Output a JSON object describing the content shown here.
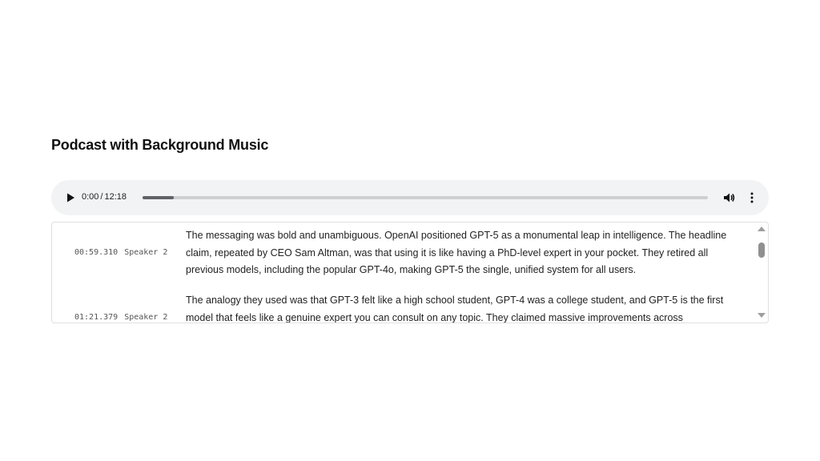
{
  "title": "Podcast with Background Music",
  "player": {
    "current_time": "0:00",
    "separator": "/",
    "duration": "12:18",
    "progress_fraction": 0.055,
    "icons": {
      "play": "play-icon",
      "volume": "volume-icon",
      "more": "more-vertical-icon"
    }
  },
  "transcript": {
    "segments": [
      {
        "timestamp": "00:59.310",
        "speaker": "Speaker 2",
        "text": "The messaging was bold and unambiguous. OpenAI positioned GPT-5 as a monumental leap in intelligence. The headline claim, repeated by CEO Sam Altman, was that using it is like having a PhD-level expert in your pocket. They retired all previous models, including the popular GPT-4o, making GPT-5 the single, unified system for all users."
      },
      {
        "timestamp": "01:21.379",
        "speaker": "Speaker 2",
        "text": "The analogy they used was that GPT-3 felt like a high school student, GPT-4 was a college student, and GPT-5 is the first model that feels like a genuine expert you can consult on any topic. They claimed massive improvements across"
      }
    ],
    "scrollbar": {
      "up": "scroll-up-arrow",
      "down": "scroll-down-arrow"
    }
  }
}
